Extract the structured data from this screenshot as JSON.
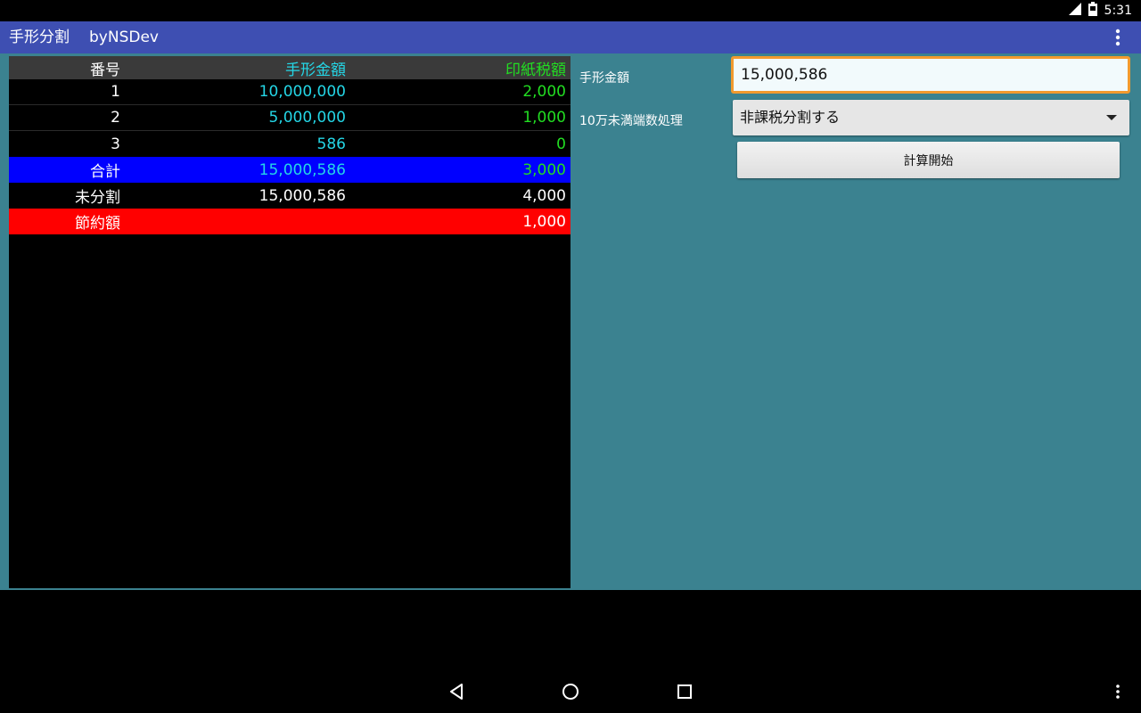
{
  "status_bar": {
    "time": "5:31"
  },
  "app_bar": {
    "title": "手形分割",
    "subtitle": "byNSDev"
  },
  "table": {
    "headers": [
      "番号",
      "手形金額",
      "印紙税額"
    ],
    "rows": [
      [
        "1",
        "10,000,000",
        "2,000"
      ],
      [
        "2",
        "5,000,000",
        "1,000"
      ],
      [
        "3",
        "586",
        "0"
      ]
    ],
    "total": {
      "label": "合計",
      "amount": "15,000,586",
      "tax": "3,000"
    },
    "undivided": {
      "label": "未分割",
      "amount": "15,000,586",
      "tax": "4,000"
    },
    "savings": {
      "label": "節約額",
      "tax": "1,000"
    }
  },
  "form": {
    "amount_label": "手形金額",
    "amount_value": "15,000,586",
    "rounding_label": "10万未満端数処理",
    "rounding_selected": "非課税分割する",
    "calc_button": "計算開始"
  },
  "colors": {
    "app_bar": "#3e4fb2",
    "panel_bg": "#3b8290",
    "amount_text": "#24d6e6",
    "tax_text": "#22dd22",
    "total_row": "#0000ff",
    "savings_row": "#ff0000",
    "input_focus": "#f29a2e"
  }
}
